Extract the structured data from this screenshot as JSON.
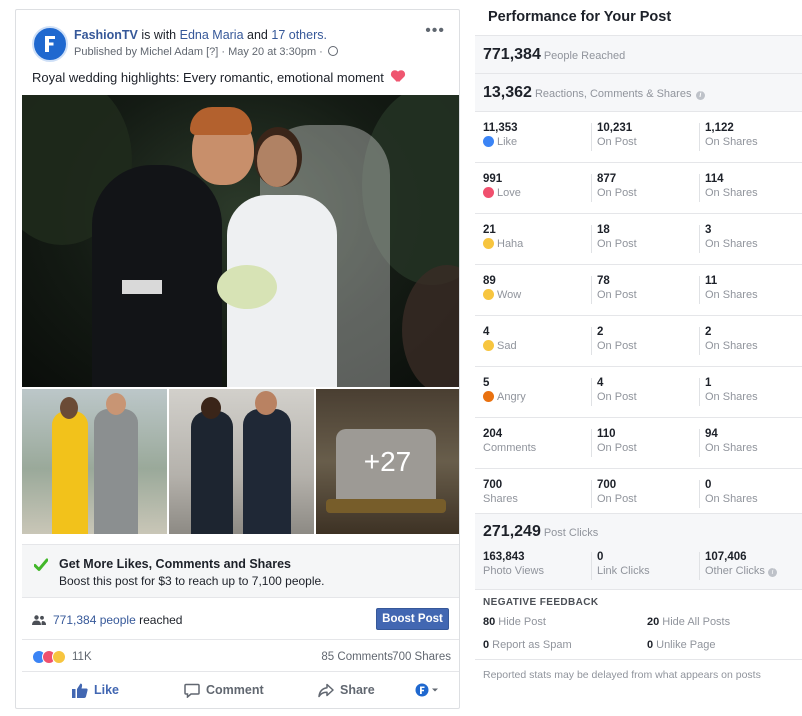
{
  "post": {
    "page_name": "FashionTV",
    "with_text": "is with",
    "tagged_person": "Edna Maria",
    "and_text": "and",
    "others": "17 others.",
    "published_by": "Published by Michel Adam [?] · May 20 at 3:30pm ·",
    "text": "Royal wedding highlights: Every romantic, emotional moment",
    "more_photos": "+27"
  },
  "boost": {
    "title": "Get More Likes, Comments and Shares",
    "subtitle": "Boost this post for $3 to reach up to 7,100 people.",
    "reach_count": "771,384 people",
    "reach_suffix": "reached",
    "button_label": "Boost Post"
  },
  "summary": {
    "reactions": "11K",
    "comments": "85 Comments",
    "shares": "700 Shares"
  },
  "actions": {
    "like": "Like",
    "comment": "Comment",
    "share": "Share"
  },
  "performance": {
    "title": "Performance for Your Post",
    "people_reached": "771,384",
    "people_reached_label": "People Reached",
    "engagements": "13,362",
    "engagements_label": "Reactions, Comments & Shares",
    "rows": [
      {
        "total": "11,353",
        "label": "Like",
        "on_post": "10,231",
        "on_shares": "1,122",
        "icon": "like-icon",
        "color": "#3b84f5"
      },
      {
        "total": "991",
        "label": "Love",
        "on_post": "877",
        "on_shares": "114",
        "icon": "love-icon",
        "color": "#f0506e"
      },
      {
        "total": "21",
        "label": "Haha",
        "on_post": "18",
        "on_shares": "3",
        "icon": "haha-icon",
        "color": "#f7c53f"
      },
      {
        "total": "89",
        "label": "Wow",
        "on_post": "78",
        "on_shares": "11",
        "icon": "wow-icon",
        "color": "#f7c53f"
      },
      {
        "total": "4",
        "label": "Sad",
        "on_post": "2",
        "on_shares": "2",
        "icon": "sad-icon",
        "color": "#f7c53f"
      },
      {
        "total": "5",
        "label": "Angry",
        "on_post": "4",
        "on_shares": "1",
        "icon": "angry-icon",
        "color": "#e9710f"
      },
      {
        "total": "204",
        "label": "Comments",
        "on_post": "110",
        "on_shares": "94"
      },
      {
        "total": "700",
        "label": "Shares",
        "on_post": "700",
        "on_shares": "0"
      }
    ],
    "on_post_label": "On Post",
    "on_shares_label": "On Shares",
    "post_clicks": "271,249",
    "post_clicks_label": "Post Clicks",
    "clicks": [
      {
        "value": "163,843",
        "label": "Photo Views"
      },
      {
        "value": "0",
        "label": "Link Clicks"
      },
      {
        "value": "107,406",
        "label": "Other Clicks"
      }
    ],
    "negative_title": "NEGATIVE FEEDBACK",
    "negative": [
      {
        "value": "80",
        "label": "Hide Post"
      },
      {
        "value": "20",
        "label": "Hide All Posts"
      },
      {
        "value": "0",
        "label": "Report as Spam"
      },
      {
        "value": "0",
        "label": "Unlike Page"
      }
    ],
    "disclaimer": "Reported stats may be delayed from what appears on posts"
  }
}
